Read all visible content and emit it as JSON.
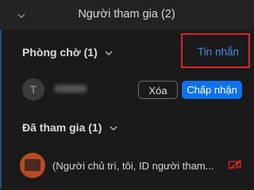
{
  "header": {
    "title": "Người tham gia (2)",
    "chevron": "chevron-down-icon"
  },
  "waiting_room": {
    "title": "Phòng chờ (1)",
    "messages_link": "Tin nhắn",
    "attendee": {
      "avatar_letter": "T",
      "remove_label": "Xóa",
      "admit_label": "Chấp nhận"
    }
  },
  "joined": {
    "title": "Đã tham gia (1)",
    "host_label": "(Người chủ trì, tôi, ID người tham..."
  },
  "colors": {
    "accent": "#0e71eb",
    "link": "#4a90e2",
    "highlight": "#e0242c",
    "camera_off": "#e0242c",
    "host_avatar": "#b84a24"
  }
}
